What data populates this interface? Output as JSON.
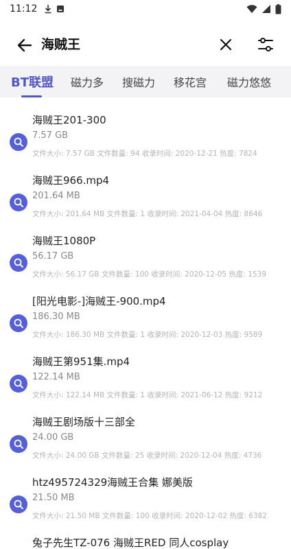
{
  "status_bar": {
    "time": "11:12"
  },
  "search": {
    "query": "海贼王"
  },
  "tabs": [
    {
      "label": "BT联盟",
      "active": true
    },
    {
      "label": "磁力多",
      "active": false
    },
    {
      "label": "搜磁力",
      "active": false
    },
    {
      "label": "移花宫",
      "active": false
    },
    {
      "label": "磁力悠悠",
      "active": false
    }
  ],
  "results": [
    {
      "name": "海贼王201-300",
      "size": "7.57 GB",
      "meta": "文件大小: 7.57 GB   文件数量: 94   收录时间: 2020-12-21   热度: 7824"
    },
    {
      "name": "海贼王966.mp4",
      "size": "201.64 MB",
      "meta": "文件大小: 201.64 MB   文件数量: 1   收录时间: 2021-04-04   热度: 8646"
    },
    {
      "name": "海贼王1080P",
      "size": "56.17 GB",
      "meta": "文件大小: 56.17 GB   文件数量: 100   收录时间: 2020-12-05   热度: 1539"
    },
    {
      "name": "[阳光电影-]海贼王-900.mp4",
      "size": "186.30 MB",
      "meta": "文件大小: 186.30 MB   文件数量: 1   收录时间: 2020-12-03   热度: 9589"
    },
    {
      "name": "海贼王第951集.mp4",
      "size": "122.14 MB",
      "meta": "文件大小: 122.14 MB   文件数量: 1   收录时间: 2021-06-12   热度: 9212"
    },
    {
      "name": "海贼王剧场版十三部全",
      "size": "24.00 GB",
      "meta": "文件大小: 24.00 GB   文件数量: 25   收录时间: 2020-12-04   热度: 4736"
    },
    {
      "name": "htz495724329海贼王合集 娜美版",
      "size": "21.50 MB",
      "meta": "文件大小: 21.50 MB   文件数量: 100   收录时间: 2020-12-02   热度: 6382"
    },
    {
      "name": "兔子先生TZ-076 海贼王RED 同人cosplay",
      "size": "",
      "meta": ""
    }
  ]
}
